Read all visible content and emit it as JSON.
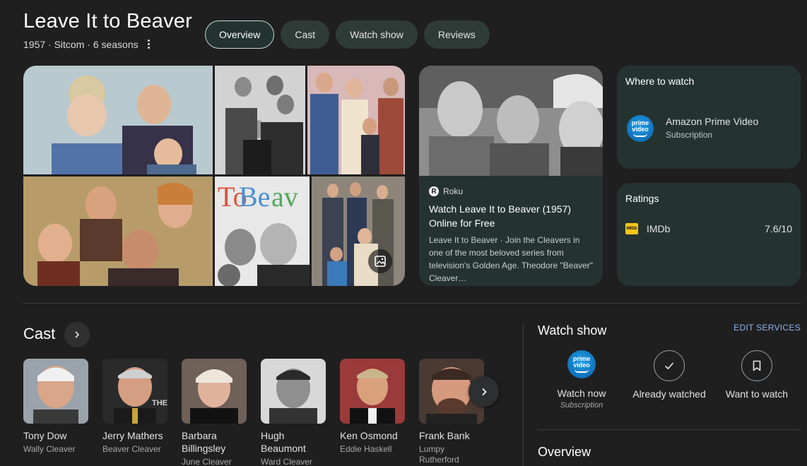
{
  "header": {
    "title": "Leave It to Beaver",
    "subtitle": "1957 · Sitcom · 6 seasons",
    "more_icon": "more-vert-icon"
  },
  "tabs": [
    {
      "label": "Overview",
      "active": true
    },
    {
      "label": "Cast",
      "active": false
    },
    {
      "label": "Watch show",
      "active": false
    },
    {
      "label": "Reviews",
      "active": false
    }
  ],
  "gallery": {
    "icon": "image-gallery-icon",
    "poster_text": "To Beaver"
  },
  "roku": {
    "source": "Roku",
    "source_logo": "R",
    "title": "Watch Leave It to Beaver (1957) Online for Free",
    "description": "Leave It to Beaver · Join the Cleavers in one of the most beloved series from television's Golden Age. Theodore \"Beaver\" Cleaver…"
  },
  "where_to_watch": {
    "title": "Where to watch",
    "service": "Amazon Prime Video",
    "plan": "Subscription",
    "logo_text_1": "prime",
    "logo_text_2": "video"
  },
  "ratings": {
    "title": "Ratings",
    "source": "IMDb",
    "score": "7.6/10",
    "logo_text": "IMDb"
  },
  "cast": {
    "title": "Cast",
    "members": [
      {
        "name": "Tony Dow",
        "role": "Wally Cleaver"
      },
      {
        "name": "Jerry Mathers",
        "role": "Beaver Cleaver"
      },
      {
        "name": "Barbara Billingsley",
        "role": "June Cleaver"
      },
      {
        "name": "Hugh Beaumont",
        "role": "Ward Cleaver"
      },
      {
        "name": "Ken Osmond",
        "role": "Eddie Haskell"
      },
      {
        "name": "Frank Bank",
        "role": "Lumpy Rutherford"
      }
    ],
    "photo_overlay_text": "THE"
  },
  "watch_show": {
    "title": "Watch show",
    "edit_label": "EDIT SERVICES",
    "options": [
      {
        "label": "Watch now",
        "sub": "Subscription",
        "icon": "prime-video-icon"
      },
      {
        "label": "Already watched",
        "icon": "check-icon"
      },
      {
        "label": "Want to watch",
        "icon": "bookmark-icon"
      }
    ]
  },
  "overview": {
    "title": "Overview"
  },
  "colors": {
    "background": "#1f1f1f",
    "card": "#253330",
    "tab": "#2f3b37",
    "link": "#8ab4f8"
  }
}
